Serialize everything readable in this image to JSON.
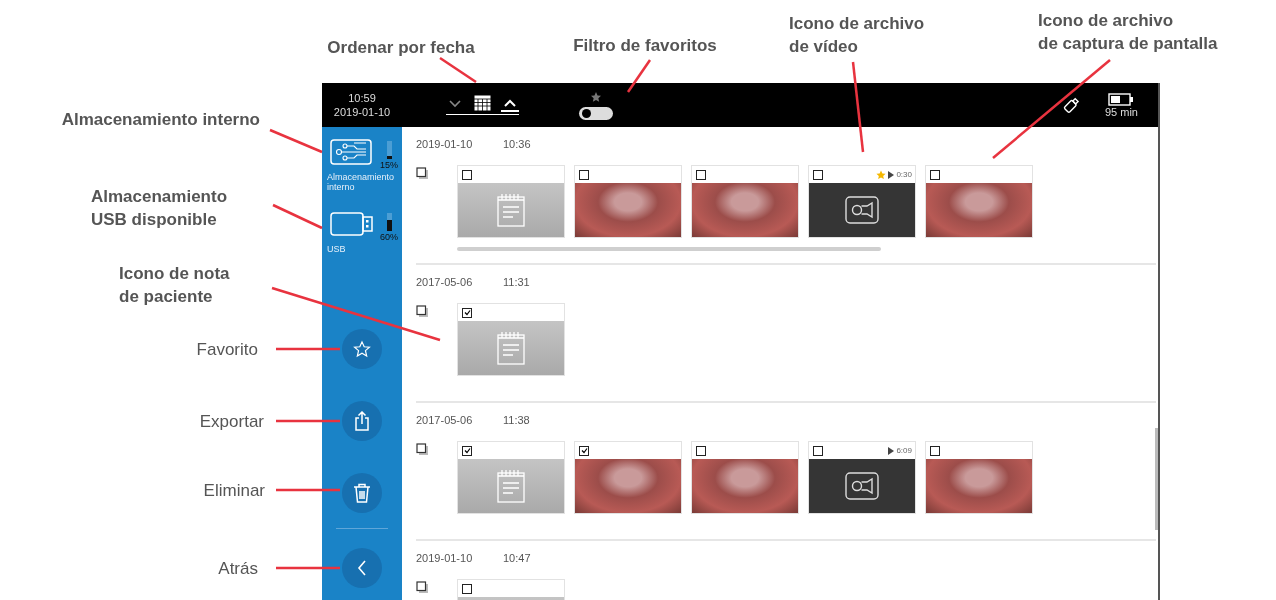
{
  "annotations": [
    {
      "text": "Ordenar por fecha",
      "bold": true
    },
    {
      "text": "Filtro de favoritos",
      "bold": true
    },
    {
      "text": "Icono de archivo\nde vídeo",
      "bold": true
    },
    {
      "text": "Icono de archivo\nde captura de pantalla",
      "bold": true
    },
    {
      "text": "Almacenamiento interno",
      "bold": true
    },
    {
      "text": "Almacenamiento\nUSB disponible",
      "bold": true
    },
    {
      "text": "Icono de nota\nde paciente",
      "bold": true
    },
    {
      "text": "Favorito",
      "bold": false
    },
    {
      "text": "Exportar",
      "bold": false
    },
    {
      "text": "Eliminar",
      "bold": false
    },
    {
      "text": "Atrás",
      "bold": false
    }
  ],
  "top_bar": {
    "time": "10:59",
    "date": "2019-01-10",
    "sort_buttons": [
      {
        "kind": "descending",
        "selected": false
      },
      {
        "kind": "ascending",
        "selected": true
      }
    ],
    "favorites_filter": {
      "on": false
    },
    "battery": "95 min"
  },
  "sidebar": {
    "storage": [
      {
        "kind": "internal",
        "label": "Almacenamiento interno",
        "usage": "15%",
        "level": 0.15
      },
      {
        "kind": "usb",
        "label": "USB",
        "usage": "60%",
        "level": 0.6
      }
    ],
    "actions": [
      {
        "kind": "favorite"
      },
      {
        "kind": "export"
      },
      {
        "kind": "delete"
      },
      {
        "kind": "back"
      }
    ]
  },
  "groups": [
    {
      "date": "2019-01-10",
      "time": "10:36",
      "items": [
        {
          "kind": "note",
          "checked": false
        },
        {
          "kind": "photo",
          "checked": false
        },
        {
          "kind": "photo",
          "checked": false
        },
        {
          "kind": "video",
          "checked": false,
          "favorite": true,
          "duration": "0:30"
        },
        {
          "kind": "photo",
          "checked": false
        }
      ]
    },
    {
      "date": "2017-05-06",
      "time": "11:31",
      "items": [
        {
          "kind": "note",
          "checked": true
        }
      ]
    },
    {
      "date": "2017-05-06",
      "time": "11:38",
      "items": [
        {
          "kind": "note",
          "checked": true
        },
        {
          "kind": "photo",
          "checked": true
        },
        {
          "kind": "photo",
          "checked": false
        },
        {
          "kind": "video",
          "checked": false,
          "favorite": false,
          "duration": "6:09"
        },
        {
          "kind": "photo",
          "checked": false
        }
      ]
    },
    {
      "date": "2019-01-10",
      "time": "10:47",
      "items": [
        {
          "kind": "note",
          "checked": false
        }
      ]
    }
  ]
}
